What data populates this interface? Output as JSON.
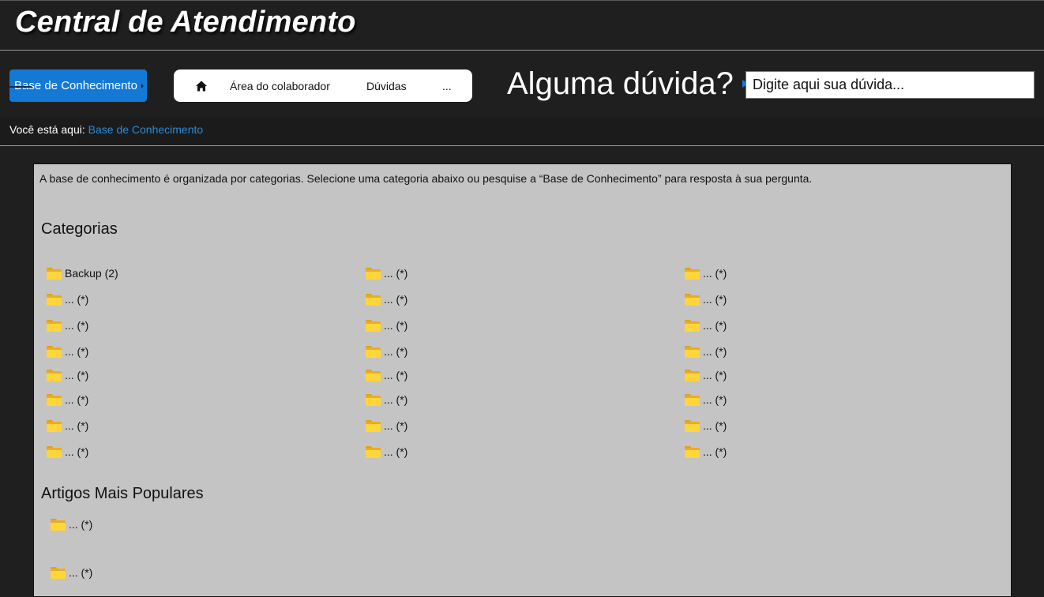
{
  "header": {
    "title": "Central de Atendimento"
  },
  "nav": {
    "kb_button": "Base de Conhecimento",
    "home_icon": "home-icon",
    "items": [
      "Área do colaborador",
      "Dúvidas",
      "..."
    ]
  },
  "search": {
    "title": "Alguma dúvida?",
    "placeholder": "Digite aqui sua dúvida..."
  },
  "breadcrumb": {
    "prefix": "Você está aqui:",
    "current": "Base de Conhecimento"
  },
  "main": {
    "intro": "A base de conhecimento é organizada por categorias. Selecione uma categoria abaixo ou pesquise a “Base de Conhecimento” para resposta à sua pergunta.",
    "categories_title": "Categorias",
    "categories": [
      [
        "Backup (2)",
        "... (*)",
        "... (*)"
      ],
      [
        "... (*)",
        "... (*)",
        "... (*)"
      ],
      [
        "... (*)",
        "... (*)",
        "... (*)"
      ],
      [
        "... (*)",
        "... (*)",
        "... (*)"
      ],
      [
        "... (*)",
        "... (*)",
        "... (*)"
      ],
      [
        "... (*)",
        "... (*)",
        "... (*)"
      ],
      [
        "... (*)",
        "... (*)",
        "... (*)"
      ],
      [
        "... (*)",
        "... (*)",
        "... (*)"
      ]
    ],
    "popular_title": "Artigos Mais Populares",
    "popular": [
      "... (*)",
      "... (*)"
    ]
  },
  "colors": {
    "accent": "#1479d4",
    "link": "#2a8ad8",
    "content_bg": "#c4c4c4",
    "page_bg": "#1f1f1f",
    "folder": "#ffd53c"
  }
}
